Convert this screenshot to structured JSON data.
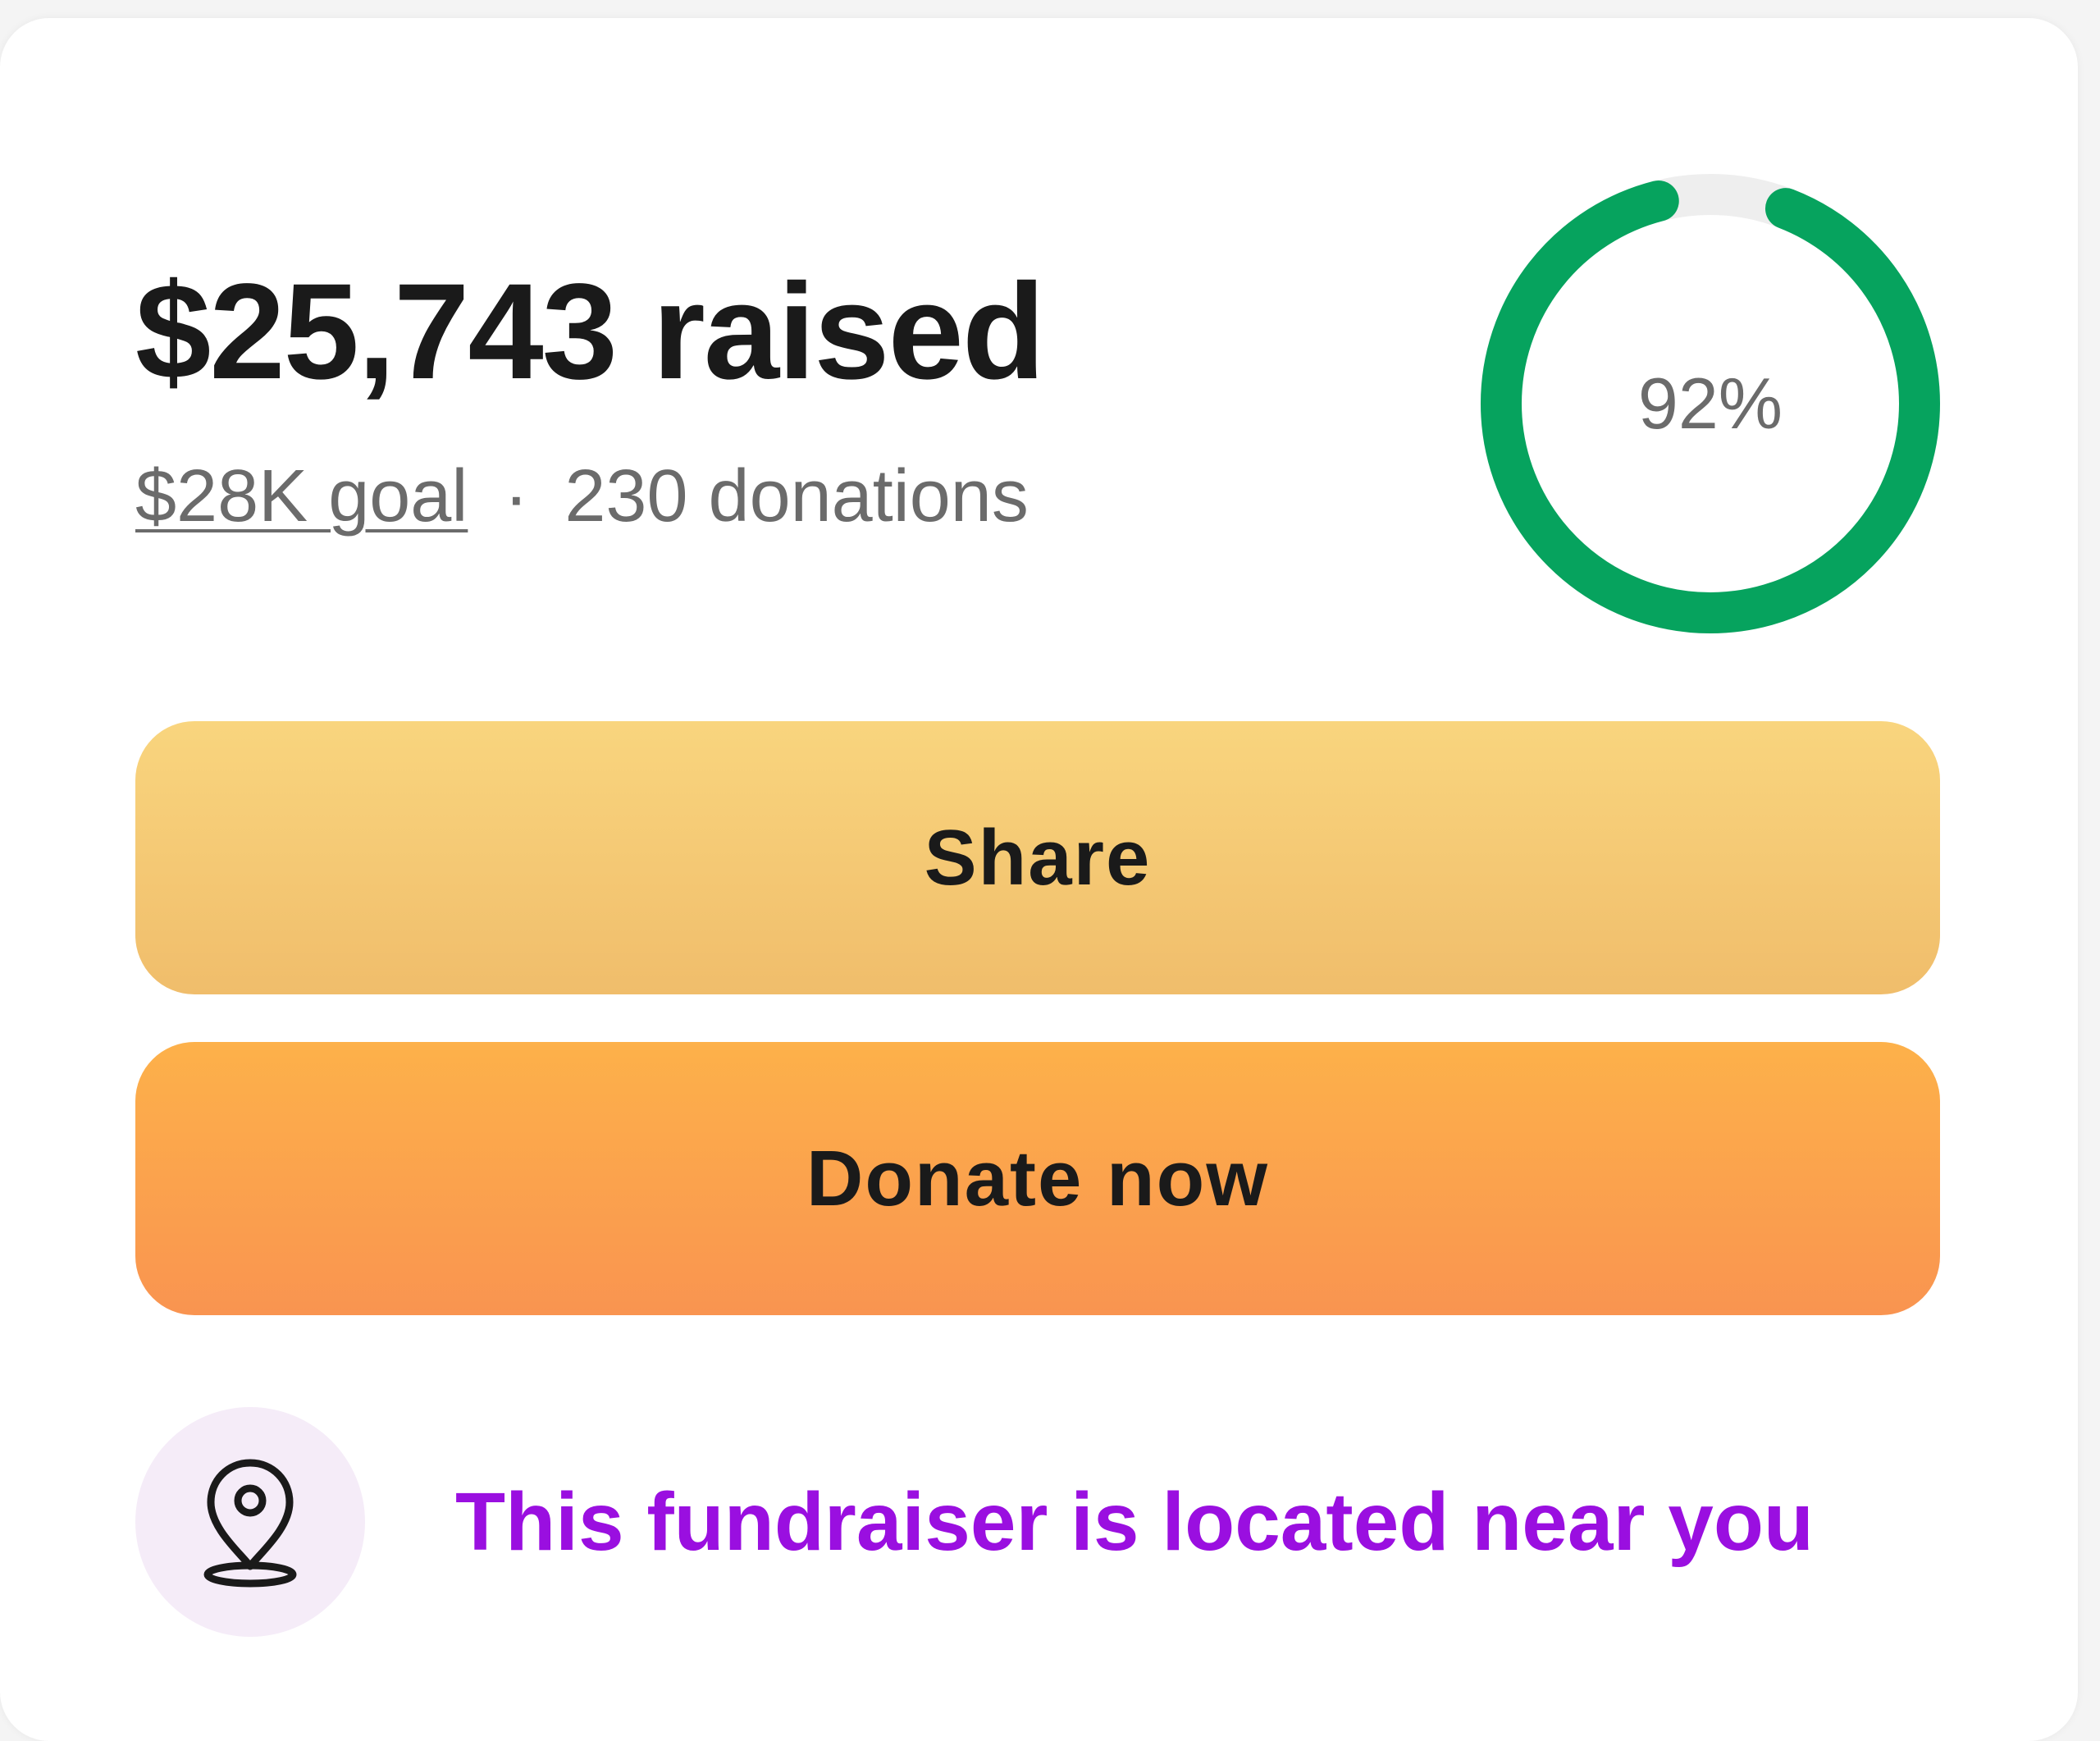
{
  "summary": {
    "raised_amount": "$25,743",
    "raised_suffix": "raised",
    "goal_text": "$28K goal",
    "separator": "·",
    "donations_text": "230 donations"
  },
  "progress": {
    "percent_label": "92%",
    "fraction": 0.92,
    "color_filled": "#06a35e",
    "color_track": "#eeeeee"
  },
  "actions": {
    "share_label": "Share",
    "donate_label": "Donate now"
  },
  "location": {
    "icon": "map-pin-icon",
    "message": "This fundraiser is located near you",
    "accent": "#9a0fe0"
  }
}
